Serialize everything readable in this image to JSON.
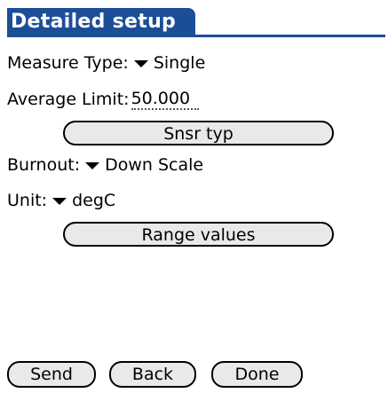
{
  "title": "Detailed setup",
  "fields": {
    "measure_type": {
      "label": "Measure Type:",
      "value": "Single",
      "icon": "dropdown-arrow-icon"
    },
    "average_limit": {
      "label": "Average Limit:",
      "value": "50.000"
    },
    "burnout": {
      "label": "Burnout:",
      "value": "Down Scale",
      "icon": "dropdown-arrow-icon"
    },
    "unit": {
      "label": "Unit:",
      "value": "degC",
      "icon": "dropdown-arrow-icon"
    }
  },
  "buttons": {
    "sensor_type": "Snsr typ",
    "range_values": "Range values",
    "send": "Send",
    "back": "Back",
    "done": "Done"
  },
  "colors": {
    "title_bar": "#1c4e97",
    "title_text": "#ffffff",
    "button_fill": "#e9e9e9",
    "background": "#ffffff"
  }
}
